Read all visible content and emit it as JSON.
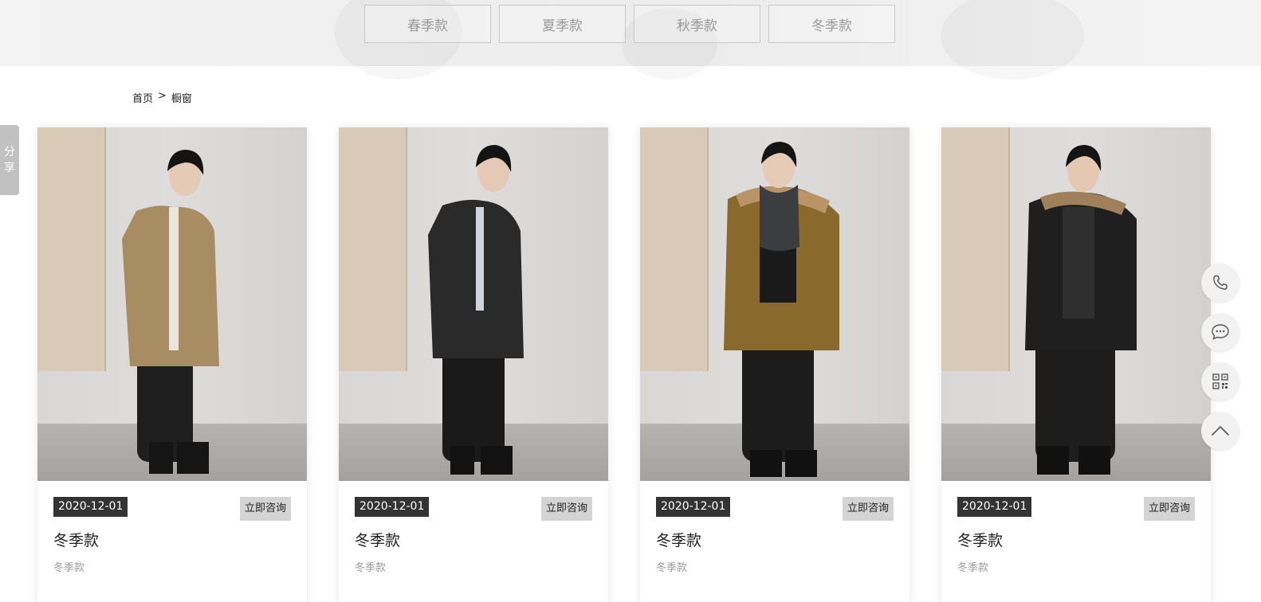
{
  "season_tabs": [
    {
      "label": "春季款"
    },
    {
      "label": "夏季款"
    },
    {
      "label": "秋季款"
    },
    {
      "label": "冬季款"
    }
  ],
  "breadcrumb": {
    "home": "首页",
    "separator": ">",
    "current": "橱窗"
  },
  "share": {
    "label_line1": "分",
    "label_line2": "享"
  },
  "products": [
    {
      "date": "2020-12-01",
      "consult_label": "立即咨询",
      "title": "冬季款",
      "subtitle": "冬季款",
      "coat_color": "#a88d63",
      "hood": "none"
    },
    {
      "date": "2020-12-01",
      "consult_label": "立即咨询",
      "title": "冬季款",
      "subtitle": "冬季款",
      "coat_color": "#2a2a2a",
      "hood": "none"
    },
    {
      "date": "2020-12-01",
      "consult_label": "立即咨询",
      "title": "冬季款",
      "subtitle": "冬季款",
      "coat_color": "#8a6a2c",
      "hood": "fur"
    },
    {
      "date": "2020-12-01",
      "consult_label": "立即咨询",
      "title": "冬季款",
      "subtitle": "冬季款",
      "coat_color": "#1f1f1f",
      "hood": "fur"
    }
  ],
  "float_tools": [
    {
      "icon": "phone-icon"
    },
    {
      "icon": "chat-icon"
    },
    {
      "icon": "qr-code-icon"
    },
    {
      "icon": "back-to-top-icon"
    }
  ],
  "colors": {
    "tab_text": "#9a9a9a",
    "date_badge_bg": "#333333",
    "consult_bg": "#d4d4d4",
    "share_bg": "#c1c1c1"
  }
}
